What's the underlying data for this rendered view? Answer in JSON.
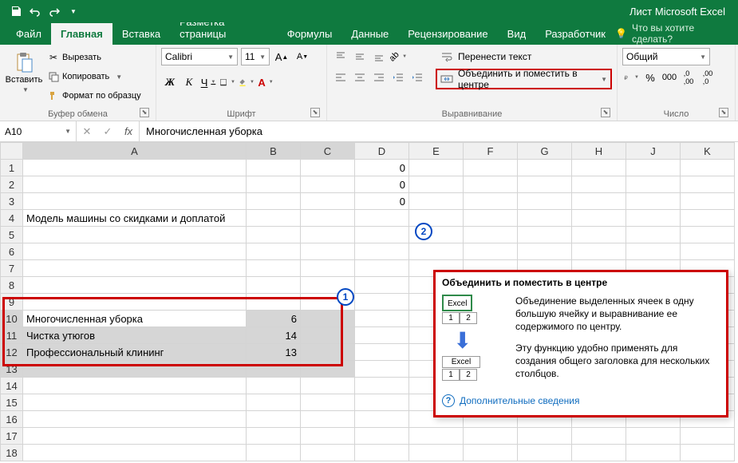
{
  "titlebar": {
    "document_title": "Лист Microsoft Excel"
  },
  "tabs": {
    "file": "Файл",
    "items": [
      "Главная",
      "Вставка",
      "Разметка страницы",
      "Формулы",
      "Данные",
      "Рецензирование",
      "Вид",
      "Разработчик"
    ],
    "active_index": 0,
    "tellme": "Что вы хотите сделать?"
  },
  "ribbon": {
    "clipboard": {
      "label": "Буфер обмена",
      "paste": "Вставить",
      "cut": "Вырезать",
      "copy": "Копировать",
      "format_painter": "Формат по образцу"
    },
    "font": {
      "label": "Шрифт",
      "name": "Calibri",
      "size": "11",
      "bold": "Ж",
      "italic": "К",
      "underline": "Ч"
    },
    "alignment": {
      "label": "Выравнивание",
      "wrap": "Перенести текст",
      "merge": "Объединить и поместить в центре"
    },
    "number": {
      "label": "Число",
      "format": "Общий"
    }
  },
  "formulabar": {
    "namebox": "A10",
    "fx": "fx",
    "content": "Многочисленная уборка"
  },
  "grid": {
    "columns": [
      "A",
      "B",
      "C",
      "D",
      "E",
      "F",
      "G",
      "H",
      "J",
      "K"
    ],
    "rows": [
      {
        "n": 1,
        "A": "",
        "D": "0"
      },
      {
        "n": 2,
        "A": "",
        "D": "0"
      },
      {
        "n": 3,
        "A": "",
        "D": "0"
      },
      {
        "n": 4,
        "A": "Модель машины со скидками и доплатой"
      },
      {
        "n": 5
      },
      {
        "n": 6
      },
      {
        "n": 7
      },
      {
        "n": 8
      },
      {
        "n": 9
      },
      {
        "n": 10,
        "A": "Многочисленная уборка",
        "B": "6"
      },
      {
        "n": 11,
        "A": "Чистка утюгов",
        "B": "14"
      },
      {
        "n": 12,
        "A": "Профессиональный клининг",
        "B": "13"
      },
      {
        "n": 13
      },
      {
        "n": 14
      },
      {
        "n": 15
      },
      {
        "n": 16
      },
      {
        "n": 17
      },
      {
        "n": 18
      }
    ]
  },
  "tooltip": {
    "title": "Объединить и поместить в центре",
    "illus_word": "Excel",
    "illus_1": "1",
    "illus_2": "2",
    "p1": "Объединение выделенных ячеек в одну большую ячейку и выравнивание ее содержимого по центру.",
    "p2": "Эту функцию удобно применять для создания общего заголовка для нескольких столбцов.",
    "more": "Дополнительные сведения"
  },
  "badges": {
    "b1": "1",
    "b2": "2"
  }
}
